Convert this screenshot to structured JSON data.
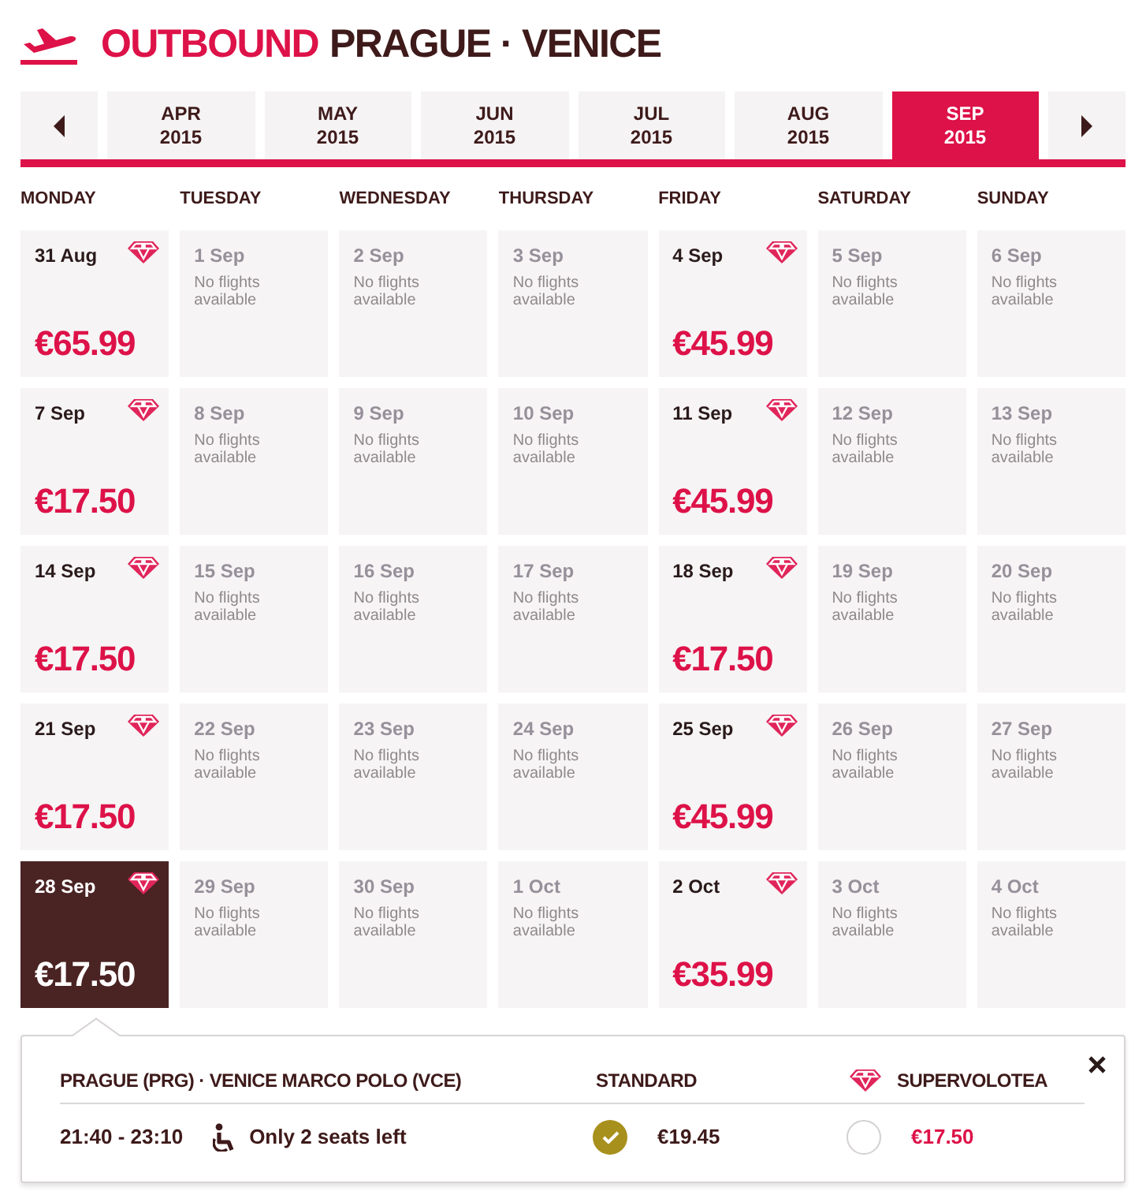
{
  "header": {
    "direction": "OUTBOUND",
    "route": "PRAGUE · VENICE"
  },
  "month_tabs": [
    {
      "month": "APR",
      "year": "2015",
      "selected": false
    },
    {
      "month": "MAY",
      "year": "2015",
      "selected": false
    },
    {
      "month": "JUN",
      "year": "2015",
      "selected": false
    },
    {
      "month": "JUL",
      "year": "2015",
      "selected": false
    },
    {
      "month": "AUG",
      "year": "2015",
      "selected": false
    },
    {
      "month": "SEP",
      "year": "2015",
      "selected": true
    }
  ],
  "weekdays": [
    "MONDAY",
    "TUESDAY",
    "WEDNESDAY",
    "THURSDAY",
    "FRIDAY",
    "SATURDAY",
    "SUNDAY"
  ],
  "weeks": [
    [
      {
        "date": "31 Aug",
        "kind": "available",
        "price": "€65.99",
        "selected": false
      },
      {
        "date": "1 Sep",
        "kind": "no_flights",
        "note": "No flights available",
        "selected": false
      },
      {
        "date": "2 Sep",
        "kind": "no_flights",
        "note": "No flights available",
        "selected": false
      },
      {
        "date": "3 Sep",
        "kind": "no_flights",
        "note": "No flights available",
        "selected": false
      },
      {
        "date": "4 Sep",
        "kind": "available",
        "price": "€45.99",
        "selected": false
      },
      {
        "date": "5 Sep",
        "kind": "no_flights",
        "note": "No flights available",
        "selected": false
      },
      {
        "date": "6 Sep",
        "kind": "no_flights",
        "note": "No flights available",
        "selected": false
      }
    ],
    [
      {
        "date": "7 Sep",
        "kind": "available",
        "price": "€17.50",
        "selected": false
      },
      {
        "date": "8 Sep",
        "kind": "no_flights",
        "note": "No flights available",
        "selected": false
      },
      {
        "date": "9 Sep",
        "kind": "no_flights",
        "note": "No flights available",
        "selected": false
      },
      {
        "date": "10 Sep",
        "kind": "no_flights",
        "note": "No flights available",
        "selected": false
      },
      {
        "date": "11 Sep",
        "kind": "available",
        "price": "€45.99",
        "selected": false
      },
      {
        "date": "12 Sep",
        "kind": "no_flights",
        "note": "No flights available",
        "selected": false
      },
      {
        "date": "13 Sep",
        "kind": "no_flights",
        "note": "No flights available",
        "selected": false
      }
    ],
    [
      {
        "date": "14 Sep",
        "kind": "available",
        "price": "€17.50",
        "selected": false
      },
      {
        "date": "15 Sep",
        "kind": "no_flights",
        "note": "No flights available",
        "selected": false
      },
      {
        "date": "16 Sep",
        "kind": "no_flights",
        "note": "No flights available",
        "selected": false
      },
      {
        "date": "17 Sep",
        "kind": "no_flights",
        "note": "No flights available",
        "selected": false
      },
      {
        "date": "18 Sep",
        "kind": "available",
        "price": "€17.50",
        "selected": false
      },
      {
        "date": "19 Sep",
        "kind": "no_flights",
        "note": "No flights available",
        "selected": false
      },
      {
        "date": "20 Sep",
        "kind": "no_flights",
        "note": "No flights available",
        "selected": false
      }
    ],
    [
      {
        "date": "21 Sep",
        "kind": "available",
        "price": "€17.50",
        "selected": false
      },
      {
        "date": "22 Sep",
        "kind": "no_flights",
        "note": "No flights available",
        "selected": false
      },
      {
        "date": "23 Sep",
        "kind": "no_flights",
        "note": "No flights available",
        "selected": false
      },
      {
        "date": "24 Sep",
        "kind": "no_flights",
        "note": "No flights available",
        "selected": false
      },
      {
        "date": "25 Sep",
        "kind": "available",
        "price": "€45.99",
        "selected": false
      },
      {
        "date": "26 Sep",
        "kind": "no_flights",
        "note": "No flights available",
        "selected": false
      },
      {
        "date": "27 Sep",
        "kind": "no_flights",
        "note": "No flights available",
        "selected": false
      }
    ],
    [
      {
        "date": "28 Sep",
        "kind": "available",
        "price": "€17.50",
        "selected": true
      },
      {
        "date": "29 Sep",
        "kind": "no_flights",
        "note": "No flights available",
        "selected": false
      },
      {
        "date": "30 Sep",
        "kind": "no_flights",
        "note": "No flights available",
        "selected": false
      },
      {
        "date": "1 Oct",
        "kind": "no_flights",
        "note": "No flights available",
        "selected": false
      },
      {
        "date": "2 Oct",
        "kind": "available",
        "price": "€35.99",
        "selected": false
      },
      {
        "date": "3 Oct",
        "kind": "no_flights",
        "note": "No flights available",
        "selected": false
      },
      {
        "date": "4 Oct",
        "kind": "no_flights",
        "note": "No flights available",
        "selected": false
      }
    ]
  ],
  "flight_details": {
    "route": "PRAGUE (PRG) · VENICE MARCO POLO (VCE)",
    "times": "21:40 - 23:10",
    "seats_note": "Only 2 seats left",
    "fare_options": [
      {
        "kind": "standard",
        "label": "STANDARD",
        "price": "€19.45",
        "selected": true
      },
      {
        "kind": "supervolotea",
        "label": "SUPERVOLOTEA",
        "price": "€17.50",
        "selected": false
      }
    ]
  }
}
